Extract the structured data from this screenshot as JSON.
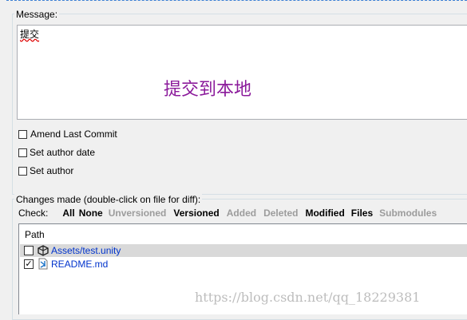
{
  "message": {
    "group_label": "Message:",
    "text": "提交",
    "overlay": "提交到本地",
    "overlay_color": "#8b1a9b"
  },
  "options": [
    {
      "label": "Amend Last Commit",
      "checked": false
    },
    {
      "label": "Set author date",
      "checked": false
    },
    {
      "label": "Set author",
      "checked": false
    }
  ],
  "changes": {
    "group_label": "Changes made (double-click on file for diff):",
    "check_label": "Check:",
    "filters": [
      {
        "label": "All",
        "enabled": true
      },
      {
        "label": "None",
        "enabled": true
      },
      {
        "label": "Unversioned",
        "enabled": false
      },
      {
        "label": "Versioned",
        "enabled": true
      },
      {
        "label": "Added",
        "enabled": false
      },
      {
        "label": "Deleted",
        "enabled": false
      },
      {
        "label": "Modified",
        "enabled": true
      },
      {
        "label": "Files",
        "enabled": true
      },
      {
        "label": "Submodules",
        "enabled": false
      }
    ],
    "column_path": "Path",
    "files": [
      {
        "path": "Assets/test.unity",
        "checked": false,
        "icon": "unity-icon",
        "selected": true
      },
      {
        "path": "README.md",
        "checked": true,
        "icon": "vscode-file-icon",
        "selected": false
      }
    ]
  },
  "watermark": "https://blog.csdn.net/qq_18229381",
  "colors": {
    "link": "#0033cc",
    "selected_row": "#d9d9d9"
  }
}
